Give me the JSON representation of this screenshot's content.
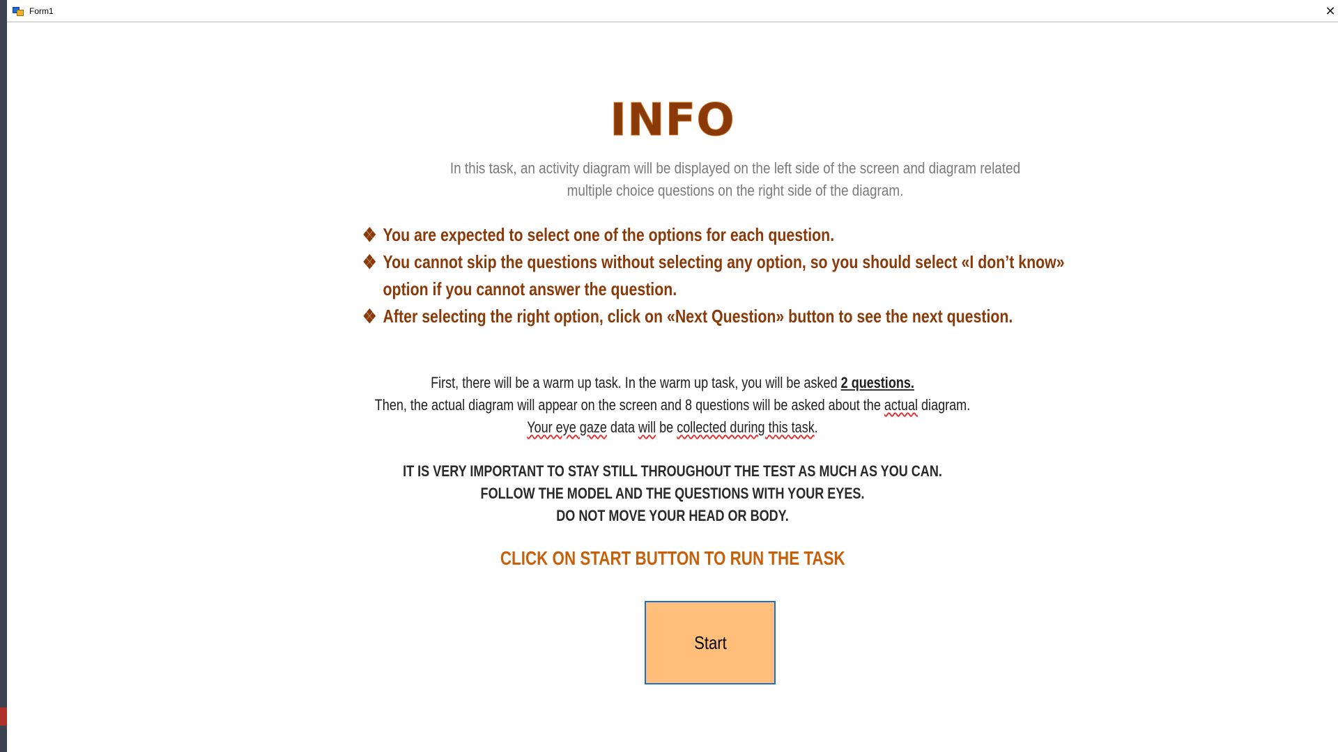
{
  "window": {
    "title": "Form1",
    "close_glyph": "✕"
  },
  "info": {
    "title": "INFO",
    "intro": "In this task, an activity diagram will be displayed on the left side of the screen and diagram related multiple choice questions on the right side of the diagram.",
    "bullet_glyph": "❖",
    "bullets": [
      "You are expected to select one of the options for each question.",
      "You cannot skip the questions without selecting any option, so you should select «I don’t know» option if you cannot answer the question.",
      "After selecting the right option, click on «Next Question» button to see the next question."
    ],
    "warmup": {
      "l1_pre": "First, there will be a warm up task. In the warm up task, you will be asked ",
      "l1_bold": "2 questions.",
      "l2_pre": "Then, the actual diagram will appear on the screen and 8 questions will be asked about the ",
      "l2_word": "actual",
      "l2_post": " diagram.",
      "l3_a": "Your eye gaze",
      "l3_b": " data ",
      "l3_c": "will",
      "l3_d": " be ",
      "l3_e": "collected during this task",
      "l3_f": "."
    },
    "caps": [
      "IT IS VERY IMPORTANT TO STAY STILL THROUGHOUT THE TEST AS MUCH AS YOU CAN.",
      "FOLLOW THE MODEL AND THE QUESTIONS WITH YOUR EYES.",
      "DO NOT MOVE YOUR HEAD OR BODY."
    ],
    "cta": "CLICK ON START BUTTON TO RUN THE TASK",
    "start_label": "Start"
  },
  "colors": {
    "title": "#8a3a08",
    "intro": "#7a7a7a",
    "cta": "#c8600a",
    "start_fill": "#ffbf7a",
    "start_border": "#1a6fd0"
  }
}
